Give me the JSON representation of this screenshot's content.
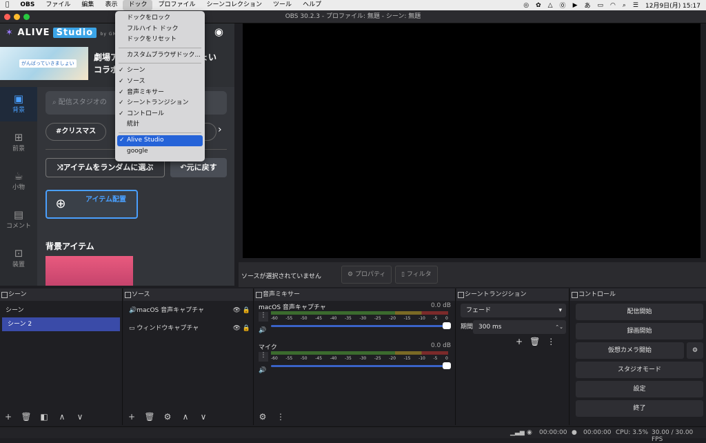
{
  "menubar": {
    "app": "OBS",
    "items": [
      "ファイル",
      "編集",
      "表示",
      "ドック",
      "プロファイル",
      "シーンコレクション",
      "ツール",
      "ヘルプ"
    ],
    "clock": "12月9日(月) 15:17",
    "ime": "あ"
  },
  "window": {
    "title": "OBS 30.2.3 - プロファイル: 無題 - シーン: 無題"
  },
  "dock_menu": {
    "items": [
      {
        "label": "ドックをロック",
        "checked": false
      },
      {
        "label": "フルハイト ドック",
        "checked": false
      },
      {
        "label": "ドックをリセット",
        "checked": false
      },
      {
        "sep": true
      },
      {
        "label": "カスタムブラウザドック...",
        "checked": false
      },
      {
        "sep": true
      },
      {
        "label": "シーン",
        "checked": true
      },
      {
        "label": "ソース",
        "checked": true
      },
      {
        "label": "音声ミキサー",
        "checked": true
      },
      {
        "label": "シーントランジション",
        "checked": true
      },
      {
        "label": "コントロール",
        "checked": true
      },
      {
        "label": "統計",
        "checked": false
      },
      {
        "sep": true
      },
      {
        "label": "Alive Studio",
        "checked": true,
        "highlight": true
      },
      {
        "label": "google",
        "checked": false
      }
    ]
  },
  "alive": {
    "logo_a": "ALIVE",
    "logo_b": "Studio",
    "logo_by": "by GM",
    "banner_tag": "がんばっていきましょい",
    "banner_text_1": "劇場ア",
    "banner_text_2": "っしょい",
    "banner_text_3": "コラボ",
    "nav": [
      {
        "label": "背景",
        "icon": "🖼",
        "active": true
      },
      {
        "label": "前景",
        "icon": "⊞",
        "active": false
      },
      {
        "label": "小物",
        "icon": "☕",
        "active": false
      },
      {
        "label": "コメント",
        "icon": "💬",
        "active": false
      },
      {
        "label": "装置",
        "icon": "⚙",
        "active": false
      }
    ],
    "search_placeholder": "配信スタジオの",
    "chips": [
      "#クリスマス",
      "景"
    ],
    "random_btn": "アイテムをランダムに選ぶ",
    "undo_btn": "元に戻す",
    "place_btn": "アイテム配置",
    "section_title": "背景アイテム"
  },
  "preview_bar": {
    "status": "ソースが選択されていません",
    "properties": "プロパティ",
    "filters": "フィルタ"
  },
  "scenes": {
    "title": "シーン",
    "items": [
      "シーン",
      "シーン 2"
    ],
    "selected": 1
  },
  "sources": {
    "title": "ソース",
    "items": [
      {
        "label": "macOS 音声キャプチャ",
        "icon": "🔊"
      },
      {
        "label": "ウィンドウキャプチャ",
        "icon": "▭"
      }
    ]
  },
  "mixer": {
    "title": "音声ミキサー",
    "channels": [
      {
        "name": "macOS 音声キャプチャ",
        "db": "0.0 dB"
      },
      {
        "name": "マイク",
        "db": "0.0 dB"
      }
    ],
    "ticks": [
      "-60",
      "-55",
      "-50",
      "-45",
      "-40",
      "-35",
      "-30",
      "-25",
      "-20",
      "-15",
      "-10",
      "-5",
      "0"
    ]
  },
  "transitions": {
    "title": "シーントランジション",
    "selected": "フェード",
    "duration_label": "期間",
    "duration": "300 ms"
  },
  "controls": {
    "title": "コントロール",
    "buttons": [
      "配信開始",
      "録画開始",
      "仮想カメラ開始",
      "スタジオモード",
      "設定",
      "終了"
    ]
  },
  "status": {
    "time1": "00:00:00",
    "time2": "00:00:00",
    "cpu": "CPU: 3.5%",
    "fps": "30.00 / 30.00 FPS"
  }
}
